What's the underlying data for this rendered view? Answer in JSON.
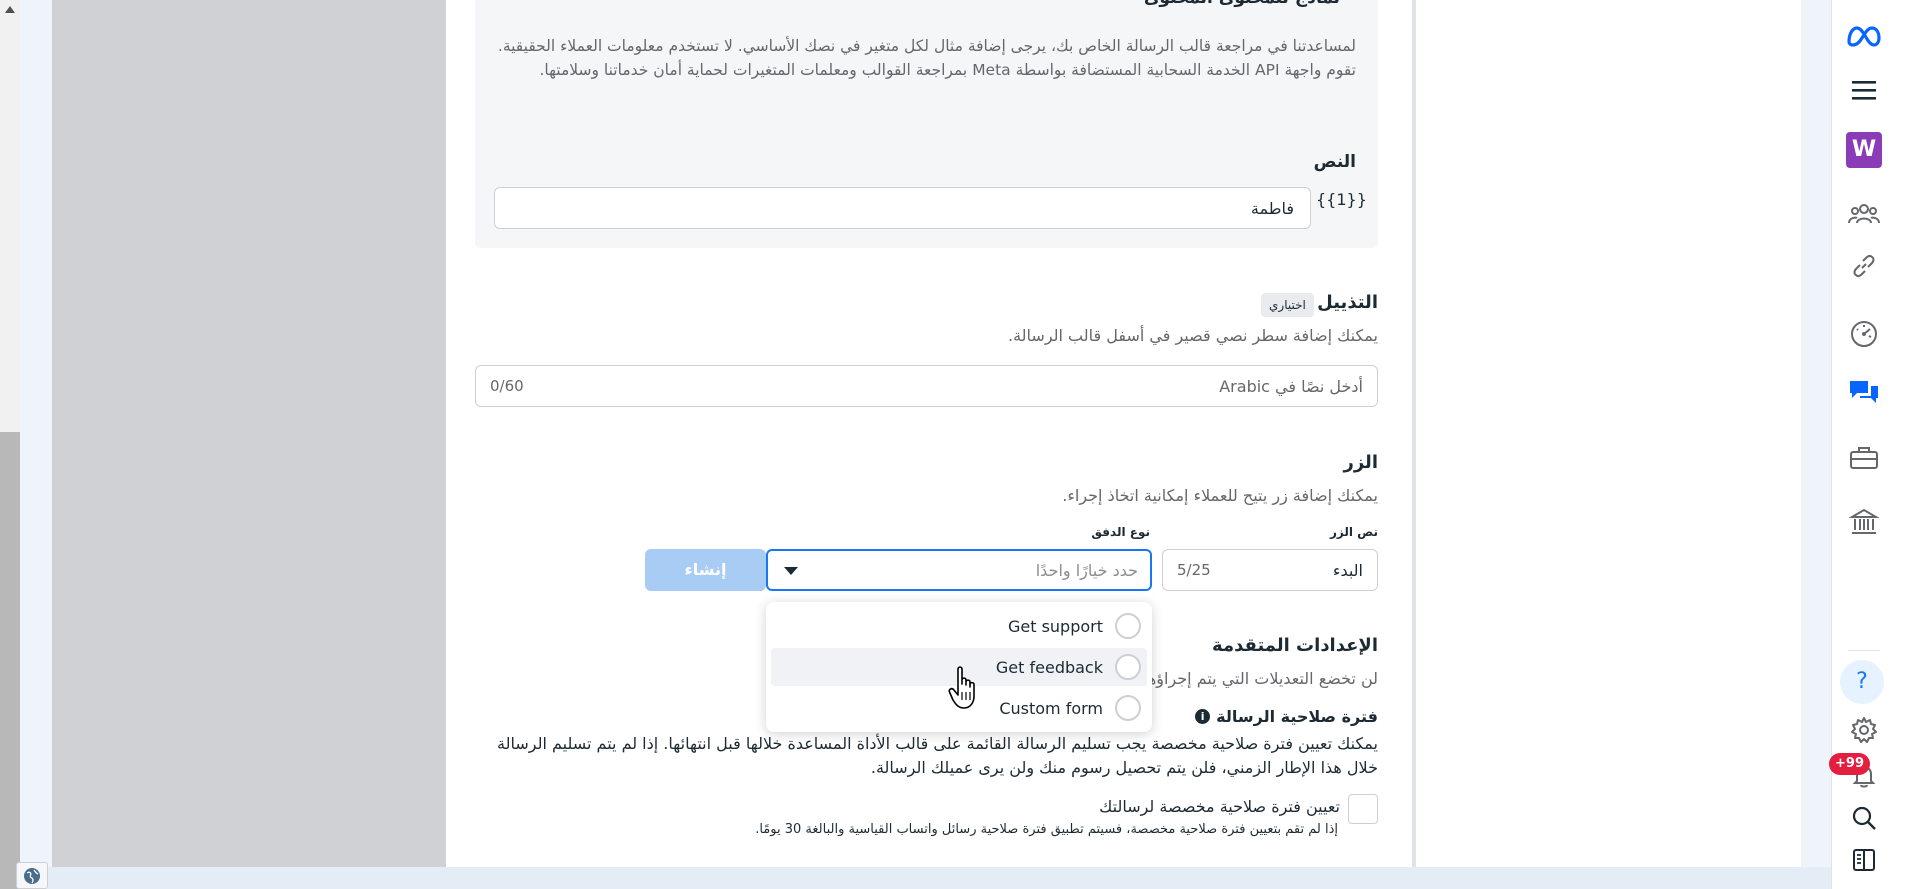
{
  "sample_section": {
    "title": "نماذج للمحتوى المحتوى",
    "description": "لمساعدتنا في مراجعة قالب الرسالة الخاص بك، يرجى إضافة مثال لكل متغير في نصك الأساسي. لا تستخدم معلومات العملاء الحقيقية. تقوم واجهة API الخدمة السحابية المستضافة بواسطة Meta بمراجعة القوالب ومعلمات المتغيرات لحماية أمان خدماتنا وسلامتها.",
    "body_label": "النص",
    "variable_token": "{{1}}",
    "variable_value": "فاطمة"
  },
  "footer_section": {
    "title": "التذييل",
    "optional_badge": "اختياري",
    "description": "يمكنك إضافة سطر نصي قصير في أسفل قالب الرسالة.",
    "input_placeholder": "أدخل نصًا في Arabic",
    "char_count": "0/60"
  },
  "button_section": {
    "title": "الزر",
    "description": "يمكنك إضافة زر يتيح للعملاء إمكانية اتخاذ إجراء.",
    "button_text_label": "نص الزر",
    "flow_type_label": "نوع الدفق",
    "button_text_value": "البدء",
    "button_text_count": "5/25",
    "flow_select_placeholder": "حدد خيارًا واحدًا",
    "create_label": "إنشاء",
    "dropdown_options": [
      "Get support",
      "Get feedback",
      "Custom form"
    ]
  },
  "advanced_section": {
    "title": "الإعدادات المتقدمة",
    "description": "لن تخضع التعديلات التي يتم إجراؤها على هذه الإعدادات للمراجعة، ويمكنك إجراء التعديلات.",
    "validity_title": "فترة صلاحية الرسالة",
    "validity_description": "يمكنك تعيين فترة صلاحية مخصصة يجب تسليم الرسالة القائمة على قالب الأداة المساعدة خلالها قبل انتهائها. إذا لم يتم تسليم الرسالة خلال هذا الإطار الزمني، فلن يتم تحصيل رسوم منك ولن يرى عميلك الرسالة.",
    "custom_validity_label": "تعيين فترة صلاحية مخصصة لرسالتك",
    "custom_validity_note": "إذا لم تقم بتعيين فترة صلاحية مخصصة، فسيتم تطبيق فترة صلاحية رسائل واتساب القياسية والبالغة 30 يومًا."
  },
  "sidebar": {
    "workspace_initial": "W",
    "notification_count": "+99",
    "icons": [
      "meta-logo-icon",
      "menu-icon",
      "workspace-avatar",
      "people-icon",
      "link-icon",
      "gauge-icon",
      "chat-icon",
      "briefcase-icon",
      "bank-icon",
      "help-icon",
      "settings-icon",
      "bell-icon",
      "search-icon",
      "panel-icon"
    ]
  },
  "colors": {
    "accent": "#1877f2",
    "create_button_disabled": "#a9ccf5",
    "workspace_avatar": "#8a3bb5",
    "badge": "#e41e3f"
  }
}
